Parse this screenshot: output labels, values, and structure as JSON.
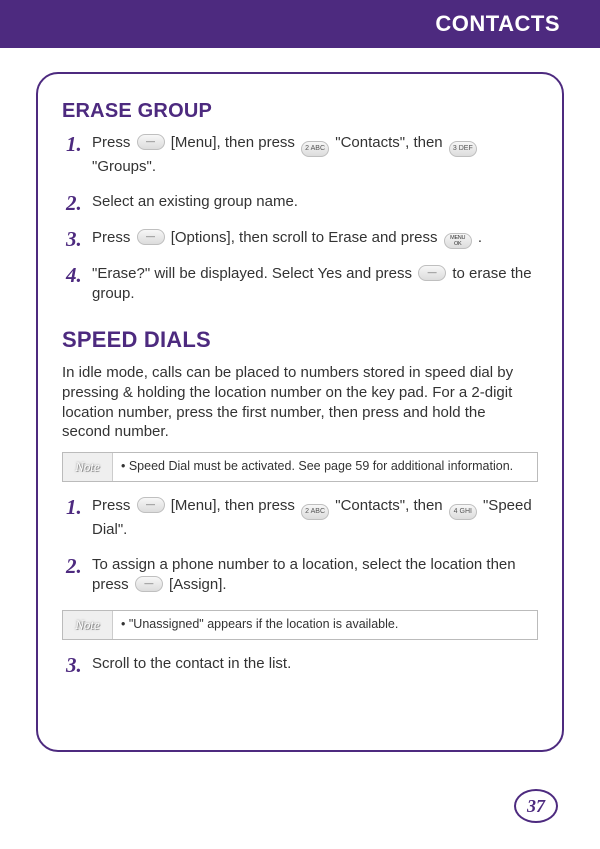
{
  "header": {
    "title": "CONTACTS"
  },
  "sections": {
    "eraseGroup": {
      "title": "ERASE GROUP",
      "steps": {
        "s1a": "Press ",
        "s1b": " [Menu], then press ",
        "s1c": " \"Contacts\", then ",
        "s1d": " \"Groups\".",
        "s2": "Select an existing group name.",
        "s3a": "Press ",
        "s3b": " [Options], then scroll to Erase and press ",
        "s3c": " .",
        "s4a": "\"Erase?\" will be displayed.  Select Yes and press ",
        "s4b": " to erase the group."
      }
    },
    "speedDials": {
      "title": "SPEED DIALS",
      "intro": "In idle mode, calls can be placed to numbers stored in speed dial by pressing & holding the location number on the key pad.  For a 2-digit location number, press the first number, then press and hold the second number.",
      "note1": "• Speed Dial must be activated. See page 59 for additional information.",
      "steps": {
        "s1a": "Press ",
        "s1b": " [Menu], then press ",
        "s1c": " \"Contacts\", then ",
        "s1d": " \"Speed Dial\".",
        "s2a": "To assign a phone number to a location, select the location then press ",
        "s2b": " [Assign].",
        "s3": "Scroll to the contact in the list."
      },
      "note2": "• \"Unassigned\" appears if the location is available."
    }
  },
  "labels": {
    "noteLabel": "Note",
    "num1": "1.",
    "num2": "2.",
    "num3": "3.",
    "num4": "4."
  },
  "keys": {
    "two": "2 ABC",
    "three": "3 DEF",
    "four": "4 GHI"
  },
  "page": {
    "number": "37"
  }
}
